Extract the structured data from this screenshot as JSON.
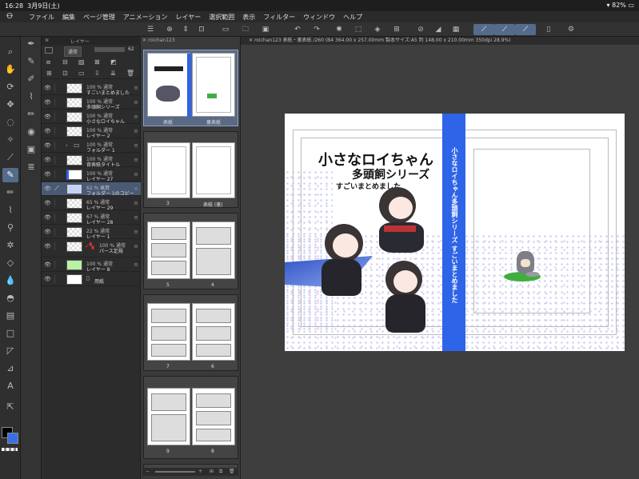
{
  "status": {
    "time": "16:28",
    "date": "3月9日(土)",
    "battery": "82%"
  },
  "menu": {
    "logo": "Ꝋ",
    "items": [
      "ファイル",
      "編集",
      "ページ管理",
      "アニメーション",
      "レイヤー",
      "選択範囲",
      "表示",
      "フィルター",
      "ウィンドウ",
      "ヘルプ"
    ]
  },
  "layer_panel": {
    "tab": "レイヤー",
    "blend_mode": "通常",
    "opacity": "62",
    "layers": [
      {
        "pct": "100 % 通常",
        "name": "すごいまとめました"
      },
      {
        "pct": "100 % 通常",
        "name": "多頭飼シリーズ"
      },
      {
        "pct": "100 % 通常",
        "name": "小さなロイちゃん"
      },
      {
        "pct": "100 % 通常",
        "name": "レイヤー 2"
      },
      {
        "pct": "100 % 通常",
        "name": "フォルダー 1"
      },
      {
        "pct": "100 % 通常",
        "name": "背表紙タイトル"
      },
      {
        "pct": "100 % 通常",
        "name": "レイヤー 27"
      },
      {
        "pct": "62 % 乗算",
        "name": "フォルダー 1のコピー"
      },
      {
        "pct": "65 % 通常",
        "name": "レイヤー 29"
      },
      {
        "pct": "67 % 通常",
        "name": "レイヤー 28"
      },
      {
        "pct": "22 % 通常",
        "name": "レイヤー 1"
      },
      {
        "pct": "100 % 通常",
        "name": "パース定規"
      },
      {
        "pct": "100 % 通常",
        "name": "レイヤー 8"
      },
      {
        "pct": "",
        "name": "用紙"
      }
    ]
  },
  "page_panel": {
    "tab": "roichan123",
    "spreads": [
      {
        "left": "表紙",
        "right": "裏表紙"
      },
      {
        "left": "3",
        "right": "表紙 (裏)"
      },
      {
        "left": "5",
        "right": "4"
      },
      {
        "left": "7",
        "right": "6"
      },
      {
        "left": "9",
        "right": "8"
      }
    ]
  },
  "canvas": {
    "tab": "roichan123 表紙・裏表紙 /260 (B4 364.00 x 257.00mm 製本サイズ:A5 判 148.00 x 210.00mm 350dpi 28.9%)",
    "title_line1": "小さなロイちゃん",
    "title_line2": "多頭飼シリーズ",
    "title_line3": "すごいまとめました",
    "spine_text": "小さなロイちゃん多頭飼シリーズ すごいまとめました"
  },
  "colors": {
    "accent": "#556b8c",
    "spine_blue": "#2e64e8",
    "main_color": "#000000",
    "sub_color": "#3a6ee8"
  },
  "icons": {
    "tools": [
      "magnifier-icon",
      "hand-icon",
      "rotate-icon",
      "move-icon",
      "lasso-icon",
      "wand-icon",
      "eyedropper-icon",
      "pen-icon",
      "pencil-icon",
      "brush-icon",
      "airbrush-icon",
      "decoration-icon",
      "eraser-icon",
      "blend-icon",
      "fill-icon",
      "gradient-icon",
      "figure-icon",
      "frame-icon",
      "ruler-icon",
      "text-icon",
      "operation-icon"
    ]
  }
}
